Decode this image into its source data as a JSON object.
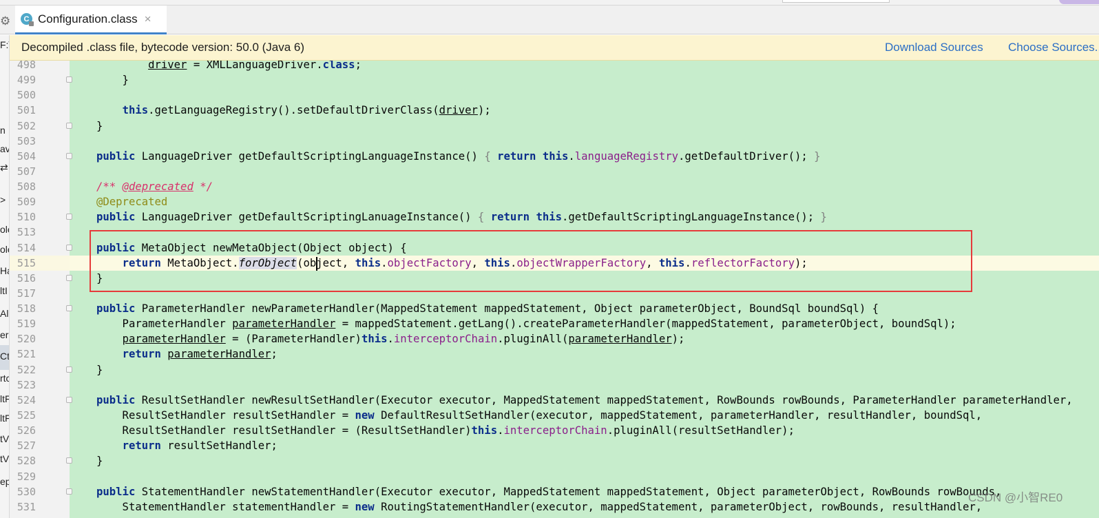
{
  "tab": {
    "icon_letter": "C",
    "title": "Configuration.class",
    "close": "×"
  },
  "banner": {
    "message": "Decompiled .class file, bytecode version: 50.0 (Java 6)",
    "download_sources": "Download Sources",
    "choose_sources": "Choose Sources..."
  },
  "left_panel": [
    "F:\\",
    "n",
    "av",
    "⇄",
    ">",
    "ole",
    "ole",
    "Ha",
    "ltI",
    "Ali",
    "er",
    "Ct",
    "rtc",
    "ltF",
    "ltF",
    "tV",
    "tV",
    "ep"
  ],
  "lines": [
    {
      "n": "498",
      "fold": false,
      "parts": [
        {
          "t": "        "
        },
        {
          "t": "driver",
          "c": "ul"
        },
        {
          "t": " = XMLLanguageDriver."
        },
        {
          "t": "class",
          "c": "kw"
        },
        {
          "t": ";"
        }
      ]
    },
    {
      "n": "499",
      "fold": true,
      "parts": [
        {
          "t": "    }"
        }
      ]
    },
    {
      "n": "500",
      "fold": false,
      "parts": [
        {
          "t": ""
        }
      ]
    },
    {
      "n": "501",
      "fold": false,
      "parts": [
        {
          "t": "    "
        },
        {
          "t": "this",
          "c": "kw"
        },
        {
          "t": ".getLanguageRegistry().setDefaultDriverClass("
        },
        {
          "t": "driver",
          "c": "ul"
        },
        {
          "t": ");"
        }
      ]
    },
    {
      "n": "502",
      "fold": true,
      "parts": [
        {
          "t": "}"
        }
      ]
    },
    {
      "n": "503",
      "fold": false,
      "parts": [
        {
          "t": ""
        }
      ]
    },
    {
      "n": "504",
      "fold": true,
      "parts": [
        {
          "t": "public",
          "c": "kw"
        },
        {
          "t": " LanguageDriver getDefaultScriptingLanguageInstance() "
        },
        {
          "t": "{",
          "c": "br"
        },
        {
          "t": " "
        },
        {
          "t": "return",
          "c": "kw"
        },
        {
          "t": " "
        },
        {
          "t": "this",
          "c": "kw"
        },
        {
          "t": "."
        },
        {
          "t": "languageRegistry",
          "c": "fld"
        },
        {
          "t": ".getDefaultDriver(); "
        },
        {
          "t": "}",
          "c": "br"
        }
      ]
    },
    {
      "n": "507",
      "fold": false,
      "parts": [
        {
          "t": ""
        }
      ]
    },
    {
      "n": "508",
      "fold": false,
      "parts": [
        {
          "t": "/** ",
          "c": "cmt"
        },
        {
          "t": "@deprecated",
          "c": "cmt ul"
        },
        {
          "t": " */",
          "c": "cmt"
        }
      ]
    },
    {
      "n": "509",
      "fold": false,
      "parts": [
        {
          "t": "@Deprecated",
          "c": "ann"
        }
      ]
    },
    {
      "n": "510",
      "fold": true,
      "parts": [
        {
          "t": "public",
          "c": "kw"
        },
        {
          "t": " LanguageDriver getDefaultScriptingLanuageInstance() "
        },
        {
          "t": "{",
          "c": "br"
        },
        {
          "t": " "
        },
        {
          "t": "return",
          "c": "kw"
        },
        {
          "t": " "
        },
        {
          "t": "this",
          "c": "kw"
        },
        {
          "t": ".getDefaultScriptingLanguageInstance(); "
        },
        {
          "t": "}",
          "c": "br"
        }
      ]
    },
    {
      "n": "513",
      "fold": false,
      "parts": [
        {
          "t": ""
        }
      ]
    },
    {
      "n": "514",
      "fold": true,
      "parts": [
        {
          "t": "public",
          "c": "kw"
        },
        {
          "t": " MetaObject newMetaObject(Object object) {"
        }
      ]
    },
    {
      "n": "515",
      "fold": false,
      "cur": true,
      "parts": [
        {
          "t": "    "
        },
        {
          "t": "return",
          "c": "kw"
        },
        {
          "t": " MetaObject."
        },
        {
          "t": "forObject",
          "c": "it hlf"
        },
        {
          "t": "(object, "
        },
        {
          "t": "this",
          "c": "kw"
        },
        {
          "t": "."
        },
        {
          "t": "objectFactory",
          "c": "fld"
        },
        {
          "t": ", "
        },
        {
          "t": "this",
          "c": "kw"
        },
        {
          "t": "."
        },
        {
          "t": "objectWrapperFactory",
          "c": "fld"
        },
        {
          "t": ", "
        },
        {
          "t": "this",
          "c": "kw"
        },
        {
          "t": "."
        },
        {
          "t": "reflectorFactory",
          "c": "fld"
        },
        {
          "t": ");"
        }
      ]
    },
    {
      "n": "516",
      "fold": true,
      "parts": [
        {
          "t": "}"
        }
      ]
    },
    {
      "n": "517",
      "fold": false,
      "parts": [
        {
          "t": ""
        }
      ]
    },
    {
      "n": "518",
      "fold": true,
      "parts": [
        {
          "t": "public",
          "c": "kw"
        },
        {
          "t": " ParameterHandler newParameterHandler(MappedStatement mappedStatement, Object parameterObject, BoundSql boundSql) {"
        }
      ]
    },
    {
      "n": "519",
      "fold": false,
      "parts": [
        {
          "t": "    ParameterHandler "
        },
        {
          "t": "parameterHandler",
          "c": "ul"
        },
        {
          "t": " = mappedStatement.getLang().createParameterHandler(mappedStatement, parameterObject, boundSql);"
        }
      ]
    },
    {
      "n": "520",
      "fold": false,
      "parts": [
        {
          "t": "    "
        },
        {
          "t": "parameterHandler",
          "c": "ul"
        },
        {
          "t": " = (ParameterHandler)"
        },
        {
          "t": "this",
          "c": "kw"
        },
        {
          "t": "."
        },
        {
          "t": "interceptorChain",
          "c": "fld"
        },
        {
          "t": ".pluginAll("
        },
        {
          "t": "parameterHandler",
          "c": "ul"
        },
        {
          "t": ");"
        }
      ]
    },
    {
      "n": "521",
      "fold": false,
      "parts": [
        {
          "t": "    "
        },
        {
          "t": "return",
          "c": "kw"
        },
        {
          "t": " "
        },
        {
          "t": "parameterHandler",
          "c": "ul"
        },
        {
          "t": ";"
        }
      ]
    },
    {
      "n": "522",
      "fold": true,
      "parts": [
        {
          "t": "}"
        }
      ]
    },
    {
      "n": "523",
      "fold": false,
      "parts": [
        {
          "t": ""
        }
      ]
    },
    {
      "n": "524",
      "fold": true,
      "parts": [
        {
          "t": "public",
          "c": "kw"
        },
        {
          "t": " ResultSetHandler newResultSetHandler(Executor executor, MappedStatement mappedStatement, RowBounds rowBounds, ParameterHandler parameterHandler,"
        }
      ]
    },
    {
      "n": "525",
      "fold": false,
      "parts": [
        {
          "t": "    ResultSetHandler resultSetHandler = "
        },
        {
          "t": "new",
          "c": "kw"
        },
        {
          "t": " DefaultResultSetHandler(executor, mappedStatement, parameterHandler, resultHandler, boundSql,"
        }
      ]
    },
    {
      "n": "526",
      "fold": false,
      "parts": [
        {
          "t": "    ResultSetHandler resultSetHandler = (ResultSetHandler)"
        },
        {
          "t": "this",
          "c": "kw"
        },
        {
          "t": "."
        },
        {
          "t": "interceptorChain",
          "c": "fld"
        },
        {
          "t": ".pluginAll(resultSetHandler);"
        }
      ]
    },
    {
      "n": "527",
      "fold": false,
      "parts": [
        {
          "t": "    "
        },
        {
          "t": "return",
          "c": "kw"
        },
        {
          "t": " resultSetHandler;"
        }
      ]
    },
    {
      "n": "528",
      "fold": true,
      "parts": [
        {
          "t": "}"
        }
      ]
    },
    {
      "n": "529",
      "fold": false,
      "parts": [
        {
          "t": ""
        }
      ]
    },
    {
      "n": "530",
      "fold": true,
      "parts": [
        {
          "t": "public",
          "c": "kw"
        },
        {
          "t": " StatementHandler newStatementHandler(Executor executor, MappedStatement mappedStatement, Object parameterObject, RowBounds rowBounds,"
        }
      ]
    },
    {
      "n": "531",
      "fold": false,
      "parts": [
        {
          "t": "    StatementHandler statementHandler = "
        },
        {
          "t": "new",
          "c": "kw"
        },
        {
          "t": " RoutingStatementHandler(executor, mappedStatement, parameterObject, rowBounds, resultHandler,"
        }
      ]
    }
  ],
  "watermark": "CSDN @小智RE0"
}
